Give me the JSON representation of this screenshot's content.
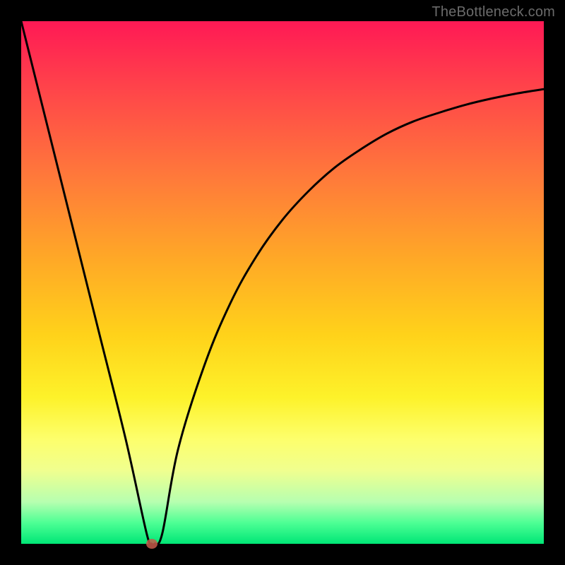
{
  "watermark": "TheBottleneck.com",
  "chart_data": {
    "type": "line",
    "title": "",
    "xlabel": "",
    "ylabel": "",
    "xlim": [
      0,
      100
    ],
    "ylim": [
      0,
      100
    ],
    "grid": false,
    "legend": false,
    "series": [
      {
        "name": "curve",
        "x": [
          0,
          5,
          10,
          15,
          20,
          24,
          25,
          25.5,
          27,
          30,
          35,
          40,
          45,
          50,
          55,
          60,
          65,
          70,
          75,
          80,
          85,
          90,
          95,
          100
        ],
        "y": [
          100,
          80,
          60,
          40,
          20,
          2,
          0,
          0,
          2,
          18,
          34,
          46,
          55,
          62,
          67.5,
          72,
          75.5,
          78.5,
          80.8,
          82.5,
          84,
          85.2,
          86.2,
          87
        ]
      }
    ],
    "marker": {
      "x": 25,
      "y": 0,
      "color": "#c65a4a"
    },
    "background_gradient": {
      "stops": [
        {
          "pos": 0.0,
          "color": "#ff1955"
        },
        {
          "pos": 0.15,
          "color": "#ff4b48"
        },
        {
          "pos": 0.3,
          "color": "#ff7a3a"
        },
        {
          "pos": 0.45,
          "color": "#ffa727"
        },
        {
          "pos": 0.6,
          "color": "#ffd21a"
        },
        {
          "pos": 0.72,
          "color": "#fdf22a"
        },
        {
          "pos": 0.8,
          "color": "#fdff6c"
        },
        {
          "pos": 0.86,
          "color": "#f0ff8f"
        },
        {
          "pos": 0.92,
          "color": "#b6ffb0"
        },
        {
          "pos": 0.96,
          "color": "#4dff94"
        },
        {
          "pos": 1.0,
          "color": "#00e676"
        }
      ]
    }
  }
}
